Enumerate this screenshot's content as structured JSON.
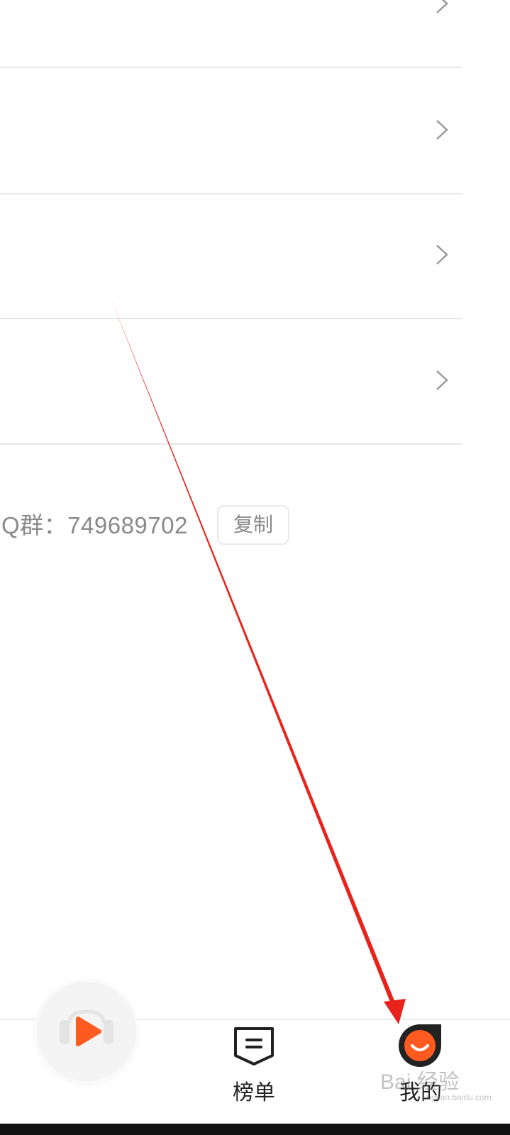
{
  "settings_rows": [
    {
      "label": ""
    },
    {
      "label": ""
    },
    {
      "label": ""
    },
    {
      "label": ""
    }
  ],
  "qq_group": {
    "text": "Q群：749689702",
    "copy_label": "复制"
  },
  "tabbar": {
    "tabs": [
      {
        "label": "",
        "icon": "play-icon"
      },
      {
        "label": "榜单",
        "icon": "list-icon"
      },
      {
        "label": "我的",
        "icon": "profile-icon"
      }
    ]
  },
  "watermark": {
    "text": "Bai 经验",
    "sub": "jingyan.baidu.com"
  },
  "colors": {
    "accent": "#ff5a1f",
    "annotation": "#e8231c"
  }
}
